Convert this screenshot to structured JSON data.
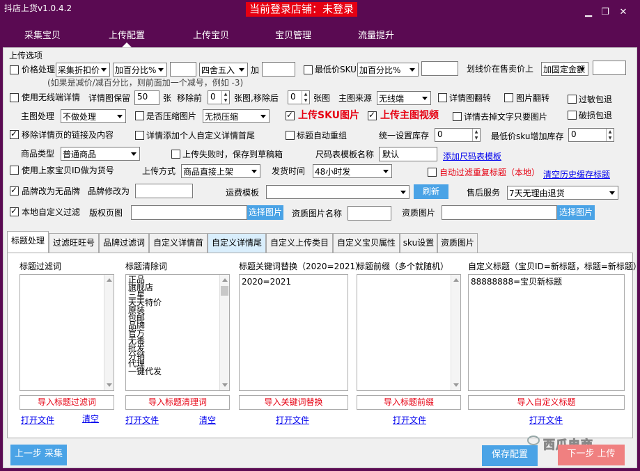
{
  "app_title": "抖店上货v1.0.4.2",
  "login_banner": "当前登录店铺：未登录",
  "window_controls": {
    "minimize": "▁",
    "restore": "❐",
    "close": "✕"
  },
  "nav": [
    "采集宝贝",
    "上传配置",
    "上传宝贝",
    "宝贝管理",
    "流量提升"
  ],
  "upload_options_title": "上传选项",
  "row1": {
    "price_label": "价格处理",
    "price_mode": "采集折扣价",
    "price_calc": "加百分比%",
    "round_mode": "四舍五入",
    "add_label": "加",
    "min_sku_label": "最低价SKU",
    "min_sku_calc": "加百分比%",
    "strike_label": "划线价在售卖价上",
    "strike_mode": "加固定金额",
    "hint": "(如果是减价/减百分比，则前面加一个减号，例如 -3)"
  },
  "row2": {
    "wireless_label": "使用无线端详情",
    "detail_keep_label": "详情图保留",
    "detail_keep_value": "50",
    "unit_zhang": "张",
    "remove_front_label": "移除前",
    "remove_front_value": "0",
    "remove_back_label": "张图,移除后",
    "remove_back_value": "0",
    "unit_zhang_img": "张图",
    "main_source_label": "主图来源",
    "main_source_value": "无线端",
    "detail_flip_label": "详情图翻转",
    "img_flip_label": "图片翻转",
    "sensitive_label": "过敏包退"
  },
  "row3": {
    "main_proc_label": "主图处理",
    "main_proc_value": "不做处理",
    "compress_label": "是否压缩图片",
    "compress_value": "无损压缩",
    "upload_sku_img": "上传SKU图片",
    "upload_main_video": "上传主图视频",
    "detail_remove_text": "详情去掉文字只要图片",
    "broken_label": "破损包退"
  },
  "row4": {
    "remove_links": "移除详情页的链接及内容",
    "detail_add_custom": "详情添加个人自定义详情首尾",
    "title_regroup": "标题自动重组",
    "stock_label": "统一设置库存",
    "stock_value": "0",
    "min_sku_stock_label": "最低价sku增加库存",
    "min_sku_stock_value": "0"
  },
  "row5": {
    "goods_type_label": "商品类型",
    "goods_type_value": "普通商品",
    "save_draft": "上传失败时，保存到草稿箱",
    "size_tpl_label": "尺码表模板名称",
    "size_tpl_value": "默认",
    "add_size_tpl": "添加尺码表模板"
  },
  "row6": {
    "use_prev_id": "使用上家宝贝ID做为货号",
    "upload_mode_label": "上传方式",
    "upload_mode_value": "商品直接上架",
    "ship_time_label": "发货时间",
    "ship_time_value": "48小时发",
    "auto_filter_dup": "自动过滤重复标题（本地）",
    "clear_history": "清空历史缓存标题"
  },
  "row7": {
    "brand_none": "品牌改为无品牌",
    "brand_modify_label": "品牌修改为",
    "freight_label": "运费模板",
    "refresh": "刷新",
    "after_sale_label": "售后服务",
    "after_sale_value": "7天无理由退货"
  },
  "row8": {
    "local_filter": "本地自定义过滤",
    "copyright_label": "版权页图",
    "choose_img": "选择图片",
    "qual_img_name_label": "资质图片名称",
    "qual_img_label": "资质图片"
  },
  "tabs": [
    "标题处理",
    "过滤旺旺号",
    "品牌过滤词",
    "自定义详情首",
    "自定义详情尾",
    "自定义上传类目",
    "自定义宝贝属性",
    "sku设置",
    "资质图片"
  ],
  "columns": [
    {
      "title": "标题过滤词",
      "items": [],
      "import": "导入标题过滤词",
      "open": "打开文件",
      "clear": "清空"
    },
    {
      "title": "标题清除词",
      "items": [
        "正品",
        "旗舰店",
        "三星",
        "天天特价",
        "原装",
        "包邮",
        "品牌",
        "官方",
        "无毒",
        "批发",
        "分销",
        "代理",
        "一键代发"
      ],
      "import": "导入标题清理词",
      "open": "打开文件",
      "clear": "清空"
    },
    {
      "title": "标题关键词替换（2020=2021）",
      "items": [
        "2020=2021"
      ],
      "import": "导入关键词替换",
      "open": "打开文件"
    },
    {
      "title": "标题前缀（多个就随机）",
      "items": [],
      "import": "导入标题前缀",
      "open": "打开文件"
    },
    {
      "title": "自定义标题（宝贝ID=新标题，标题=新标题）",
      "items": [
        "88888888=宝贝新标题"
      ],
      "import": "导入自定义标题",
      "open": "打开文件"
    }
  ],
  "bottom": {
    "prev": "上一步 采集",
    "save": "保存配置",
    "next": "下一步 上传",
    "watermark": "西瓜电商"
  },
  "colors": {
    "title_bg": "#5a0a52",
    "banner": "#e60012",
    "blue_btn": "#4aa3e6",
    "next_btn": "#f08080"
  }
}
